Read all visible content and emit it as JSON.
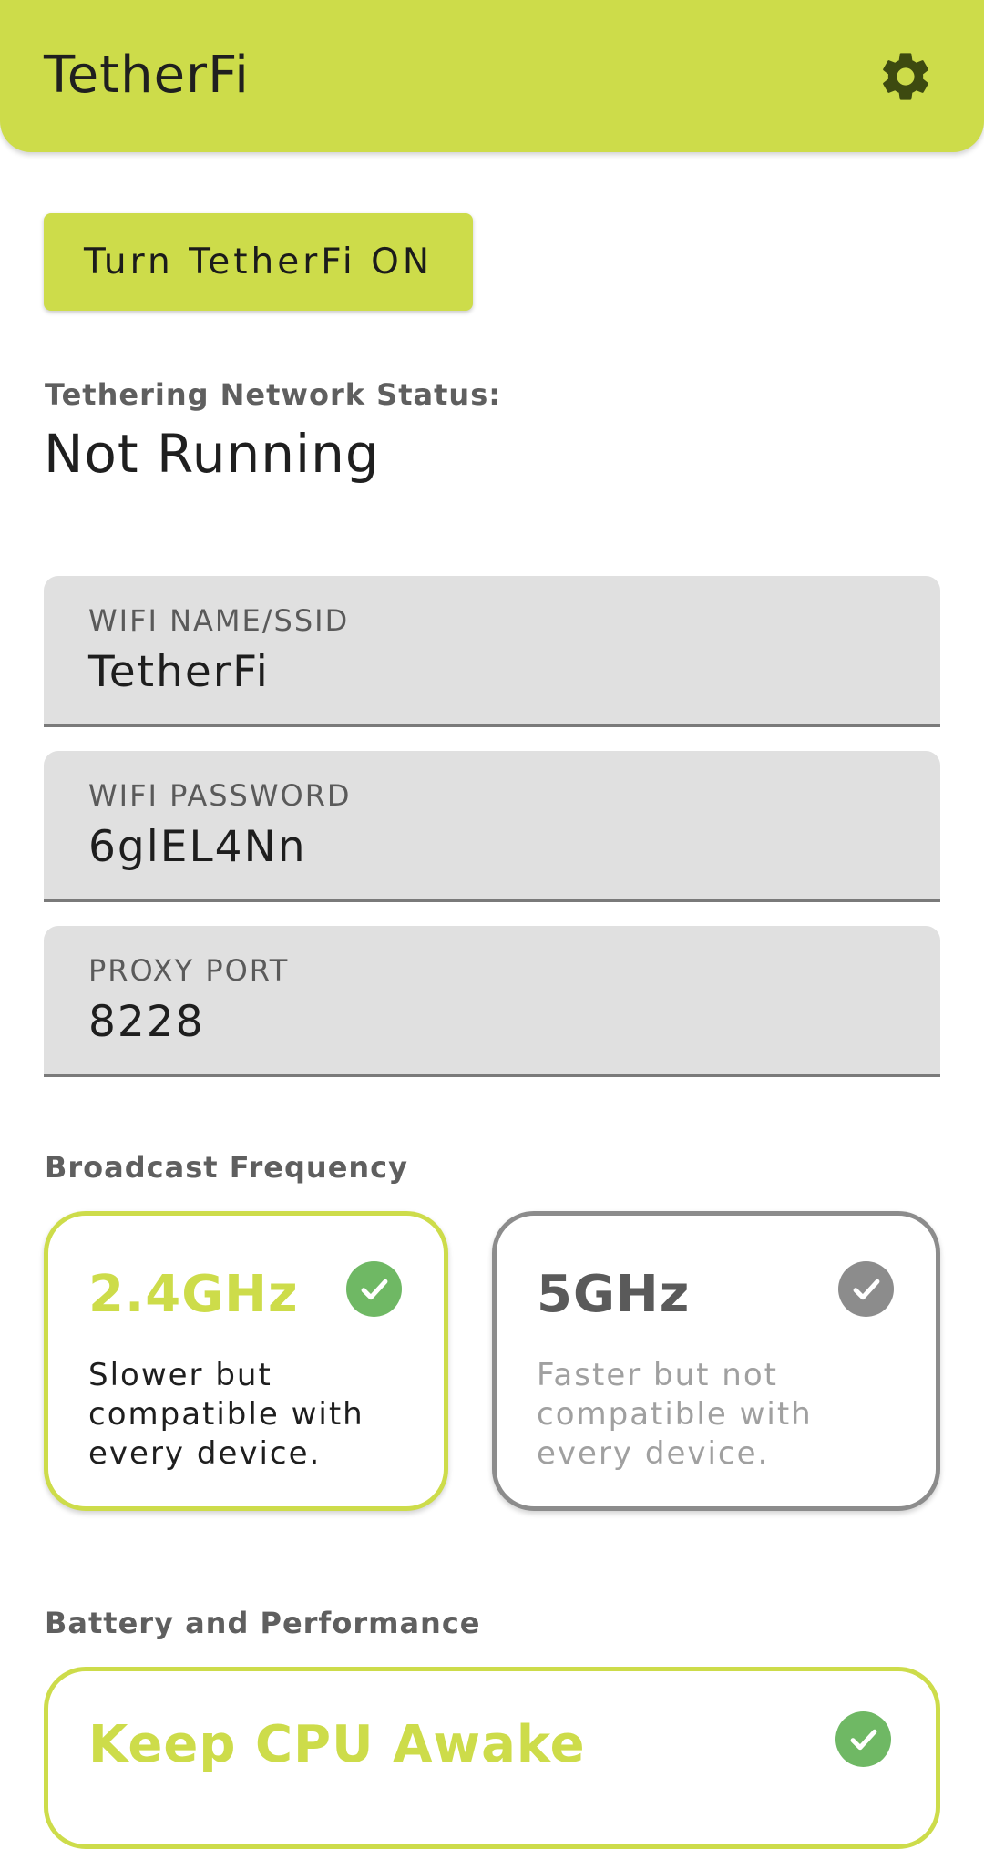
{
  "app": {
    "title": "TetherFi"
  },
  "toolbar": {
    "settings_icon": "gear-icon"
  },
  "main": {
    "toggle_label": "Turn TetherFi ON",
    "status_label": "Tethering Network Status:",
    "status_value": "Not Running"
  },
  "fields": {
    "ssid": {
      "label": "WIFI NAME/SSID",
      "value": "TetherFi"
    },
    "password": {
      "label": "WIFI PASSWORD",
      "value": "6glEL4Nn"
    },
    "port": {
      "label": "PROXY PORT",
      "value": "8228"
    }
  },
  "broadcast": {
    "label": "Broadcast Frequency",
    "options": [
      {
        "title": "2.4GHz",
        "description": "Slower but compatible with every device.",
        "selected": true,
        "icon": "check-circle-icon"
      },
      {
        "title": "5GHz",
        "description": "Faster but not compatible with every device.",
        "selected": false,
        "icon": "check-circle-icon"
      }
    ]
  },
  "battery": {
    "label": "Battery and Performance",
    "card_title": "Keep CPU Awake",
    "icon": "check-circle-icon"
  },
  "colors": {
    "accent": "#cddc4a",
    "check_active": "#6fb864",
    "check_inactive": "#8c8c8c",
    "muted_text": "#a0a0a0"
  }
}
